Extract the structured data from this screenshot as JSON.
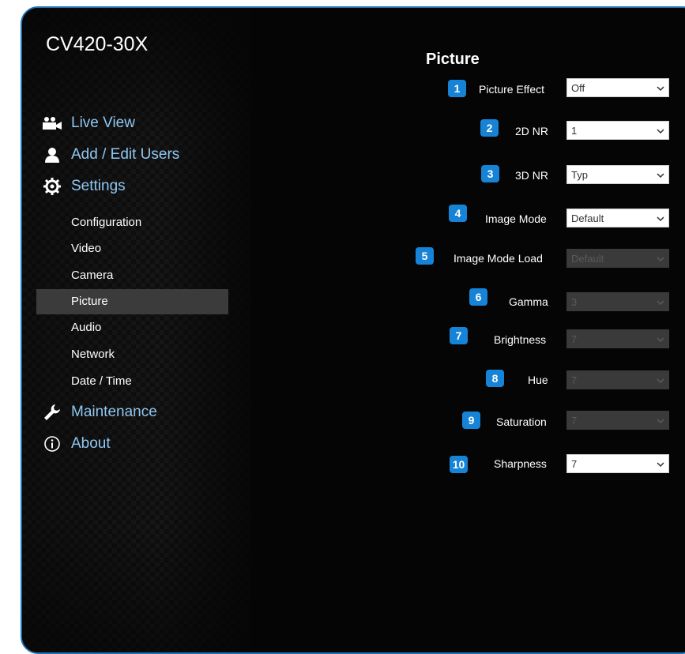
{
  "app": {
    "device_name": "CV420-30X"
  },
  "nav": {
    "live_view": "Live View",
    "add_edit_users": "Add / Edit Users",
    "settings": "Settings",
    "sub": {
      "configuration": "Configuration",
      "video": "Video",
      "camera": "Camera",
      "picture": "Picture",
      "audio": "Audio",
      "network": "Network",
      "date_time": "Date / Time"
    },
    "maintenance": "Maintenance",
    "about": "About",
    "active_item": "picture"
  },
  "page": {
    "title": "Picture",
    "fields": {
      "picture_effect": {
        "badge": "1",
        "label": "Picture Effect",
        "value": "Off",
        "enabled": true
      },
      "nr_2d": {
        "badge": "2",
        "label": "2D NR",
        "value": "1",
        "enabled": true
      },
      "nr_3d": {
        "badge": "3",
        "label": "3D NR",
        "value": "Typ",
        "enabled": true
      },
      "image_mode": {
        "badge": "4",
        "label": "Image Mode",
        "value": "Default",
        "enabled": true
      },
      "image_mode_load": {
        "badge": "5",
        "label": "Image Mode Load",
        "value": "Default",
        "enabled": false
      },
      "gamma": {
        "badge": "6",
        "label": "Gamma",
        "value": "3",
        "enabled": false
      },
      "brightness": {
        "badge": "7",
        "label": "Brightness",
        "value": "7",
        "enabled": false
      },
      "hue": {
        "badge": "8",
        "label": "Hue",
        "value": "7",
        "enabled": false
      },
      "saturation": {
        "badge": "9",
        "label": "Saturation",
        "value": "7",
        "enabled": false
      },
      "sharpness": {
        "badge": "10",
        "label": "Sharpness",
        "value": "7",
        "enabled": true
      }
    }
  },
  "colors": {
    "accent": "#1683d6",
    "nav_text": "#8fc7f2",
    "border": "#1f74b8",
    "active_row": "#3b3b3b"
  }
}
